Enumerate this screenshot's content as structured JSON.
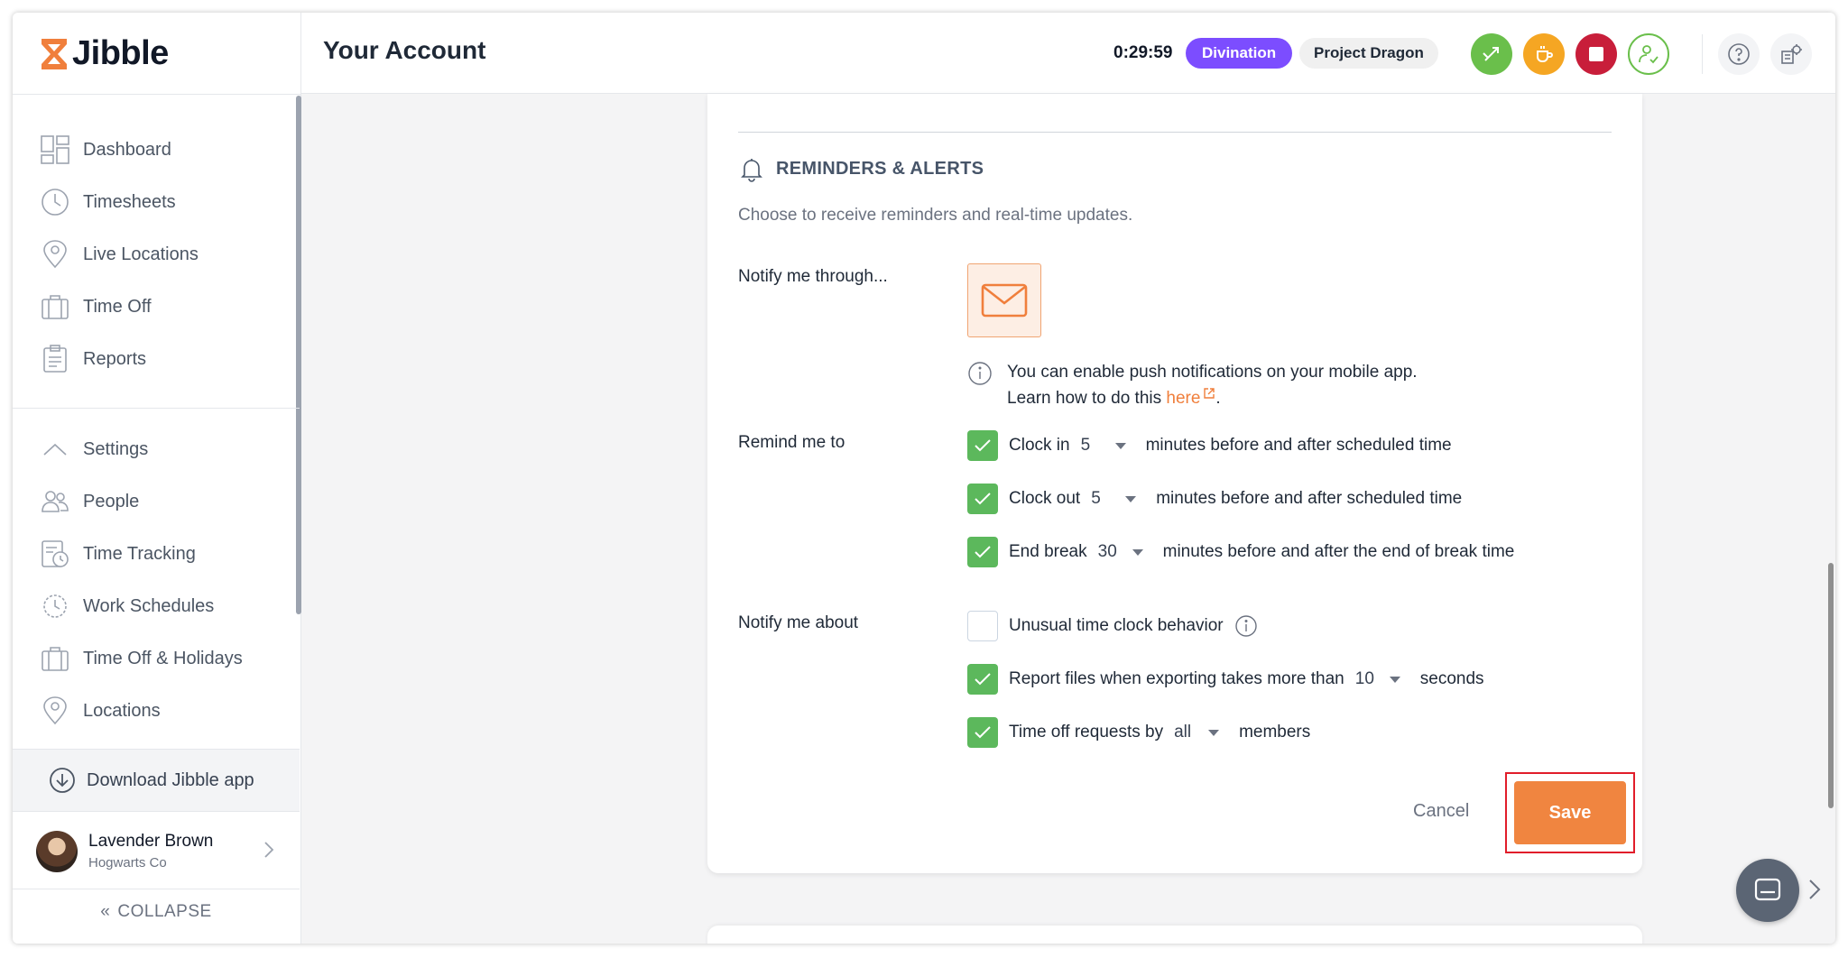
{
  "app": {
    "logo_text": "Jibble",
    "brand_color": "#f07f3c"
  },
  "header": {
    "title": "Your Account",
    "timer": "0:29:59",
    "activity": "Divination",
    "project": "Project Dragon"
  },
  "sidebar": {
    "items": [
      {
        "label": "Dashboard",
        "icon": "dashboard-icon"
      },
      {
        "label": "Timesheets",
        "icon": "clock-icon"
      },
      {
        "label": "Live Locations",
        "icon": "location-pin-icon"
      },
      {
        "label": "Time Off",
        "icon": "suitcase-icon"
      },
      {
        "label": "Reports",
        "icon": "clipboard-icon"
      }
    ],
    "settings_items": [
      {
        "label": "Settings",
        "icon": "chevron-up-icon"
      },
      {
        "label": "People",
        "icon": "people-icon"
      },
      {
        "label": "Time Tracking",
        "icon": "time-tracking-icon"
      },
      {
        "label": "Work Schedules",
        "icon": "schedule-icon"
      },
      {
        "label": "Time Off & Holidays",
        "icon": "suitcase-icon"
      },
      {
        "label": "Locations",
        "icon": "location-pin-icon"
      }
    ],
    "download_label": "Download Jibble app",
    "user": {
      "name": "Lavender Brown",
      "org": "Hogwarts Co"
    },
    "collapse_label": "COLLAPSE"
  },
  "reminders": {
    "title": "REMINDERS & ALERTS",
    "description": "Choose to receive reminders and real-time updates.",
    "notify_through_label": "Notify me through...",
    "info_line1": "You can enable push notifications on your mobile app.",
    "info_line2_prefix": "Learn how to do this ",
    "info_link": "here",
    "info_line2_suffix": ".",
    "remind_label": "Remind me to",
    "remind_options": [
      {
        "label": "Clock in",
        "value": "5",
        "after": "minutes before and after scheduled time",
        "checked": true
      },
      {
        "label": "Clock out",
        "value": "5",
        "after": "minutes before and after scheduled time",
        "checked": true
      },
      {
        "label": "End break",
        "value": "30",
        "after": "minutes before and after the end of break time",
        "checked": true
      }
    ],
    "notify_about_label": "Notify me about",
    "notify_options": {
      "unusual": {
        "label": "Unusual time clock behavior",
        "checked": false
      },
      "report": {
        "label": "Report files when exporting takes more than",
        "value": "10",
        "after": "seconds",
        "checked": true
      },
      "timeoff": {
        "label": "Time off requests by",
        "value": "all",
        "after": "members",
        "checked": true
      }
    },
    "cancel_label": "Cancel",
    "save_label": "Save"
  }
}
